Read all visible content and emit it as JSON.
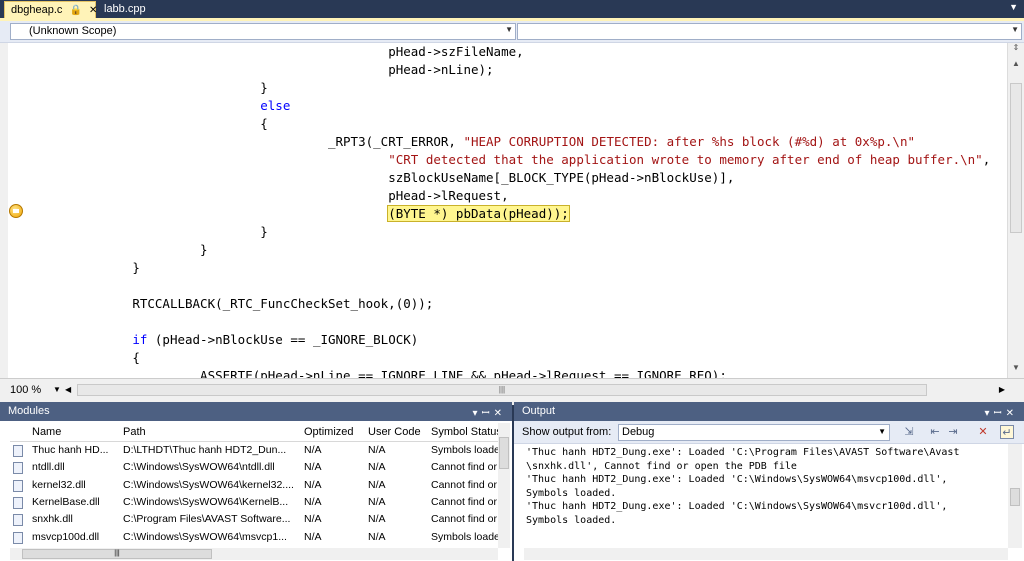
{
  "tabs": [
    {
      "label": "dbgheap.c",
      "active": true
    },
    {
      "label": "labb.cpp",
      "active": false
    }
  ],
  "editor": {
    "scope_combo": "(Unknown Scope)",
    "member_combo": "",
    "zoom": "100 %",
    "lines": [
      {
        "indent": 49,
        "tokens": [
          {
            "t": "pHead->szFileName,",
            "c": "plain"
          }
        ]
      },
      {
        "indent": 49,
        "tokens": [
          {
            "t": "pHead->nLine);",
            "c": "plain"
          }
        ]
      },
      {
        "indent": 33,
        "tokens": [
          {
            "t": "}",
            "c": "plain"
          }
        ]
      },
      {
        "indent": 33,
        "tokens": [
          {
            "t": "else",
            "c": "kw"
          }
        ]
      },
      {
        "indent": 33,
        "tokens": [
          {
            "t": "{",
            "c": "plain"
          }
        ]
      },
      {
        "indent": 41,
        "tokens": [
          {
            "t": "_RPT3(_CRT_ERROR, ",
            "c": "plain"
          },
          {
            "t": "\"HEAP CORRUPTION DETECTED: after %hs block (#%d) at 0x%p.\\n\"",
            "c": "str"
          }
        ]
      },
      {
        "indent": 49,
        "tokens": [
          {
            "t": "\"CRT detected that the application wrote to memory after end of heap buffer.\\n\"",
            "c": "str"
          },
          {
            "t": ",",
            "c": "plain"
          }
        ]
      },
      {
        "indent": 49,
        "tokens": [
          {
            "t": "szBlockUseName[_BLOCK_TYPE(pHead->nBlockUse)],",
            "c": "plain"
          }
        ]
      },
      {
        "indent": 49,
        "tokens": [
          {
            "t": "pHead->lRequest,",
            "c": "plain"
          }
        ]
      },
      {
        "indent": 49,
        "highlight": true,
        "tokens": [
          {
            "t": "(BYTE *) pbData(pHead));",
            "c": "plain"
          }
        ]
      },
      {
        "indent": 33,
        "tokens": [
          {
            "t": "}",
            "c": "plain"
          }
        ]
      },
      {
        "indent": 25,
        "tokens": [
          {
            "t": "}",
            "c": "plain"
          }
        ]
      },
      {
        "indent": 17,
        "tokens": [
          {
            "t": "}",
            "c": "plain"
          }
        ]
      },
      {
        "indent": 17,
        "tokens": []
      },
      {
        "indent": 17,
        "tokens": [
          {
            "t": "RTCCALLBACK(_RTC_FuncCheckSet_hook,(0));",
            "c": "plain"
          }
        ]
      },
      {
        "indent": 17,
        "tokens": []
      },
      {
        "indent": 17,
        "tokens": [
          {
            "t": "if",
            "c": "kw"
          },
          {
            "t": " (pHead->nBlockUse == _IGNORE_BLOCK)",
            "c": "plain"
          }
        ]
      },
      {
        "indent": 17,
        "tokens": [
          {
            "t": "{",
            "c": "plain"
          }
        ]
      },
      {
        "indent": 25,
        "tokens": [
          {
            "t": "ASSERTE(pHead->nLine == IGNORE_LINE && pHead->lRequest == IGNORE_REQ);",
            "c": "plain"
          }
        ]
      }
    ]
  },
  "modules": {
    "title": "Modules",
    "columns": [
      "Name",
      "Path",
      "Optimized",
      "User Code",
      "Symbol Status"
    ],
    "rows": [
      [
        "Thuc hanh HD...",
        "D:\\LTHDT\\Thuc hanh HDT2_Dun...",
        "N/A",
        "N/A",
        "Symbols loaded."
      ],
      [
        "ntdll.dll",
        "C:\\Windows\\SysWOW64\\ntdll.dll",
        "N/A",
        "N/A",
        "Cannot find or open"
      ],
      [
        "kernel32.dll",
        "C:\\Windows\\SysWOW64\\kernel32....",
        "N/A",
        "N/A",
        "Cannot find or open"
      ],
      [
        "KernelBase.dll",
        "C:\\Windows\\SysWOW64\\KernelB...",
        "N/A",
        "N/A",
        "Cannot find or open"
      ],
      [
        "snxhk.dll",
        "C:\\Program Files\\AVAST Software...",
        "N/A",
        "N/A",
        "Cannot find or open"
      ],
      [
        "msvcp100d.dll",
        "C:\\Windows\\SysWOW64\\msvcp1...",
        "N/A",
        "N/A",
        "Symbols loaded."
      ]
    ]
  },
  "output": {
    "title": "Output",
    "show_from_label": "Show output from:",
    "source": "Debug",
    "lines": [
      "'Thuc hanh HDT2_Dung.exe': Loaded 'C:\\Program Files\\AVAST Software\\Avast",
      "\\snxhk.dll', Cannot find or open the PDB file",
      "'Thuc hanh HDT2_Dung.exe': Loaded 'C:\\Windows\\SysWOW64\\msvcp100d.dll',",
      "Symbols loaded.",
      "'Thuc hanh HDT2_Dung.exe': Loaded 'C:\\Windows\\SysWOW64\\msvcr100d.dll',",
      "Symbols loaded."
    ]
  },
  "colors": {
    "keyword": "#0000ff",
    "string": "#a31515",
    "highlight": "#fff68f",
    "title_bar": "#4d6082"
  }
}
